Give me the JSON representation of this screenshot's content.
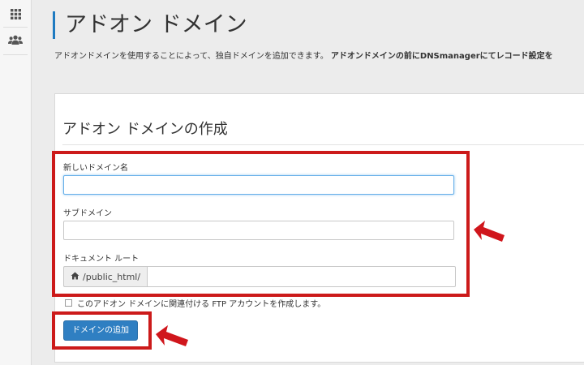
{
  "rail": {
    "icons": [
      "apps-grid-icon",
      "users-icon"
    ]
  },
  "page": {
    "title": "アドオン ドメイン",
    "description_plain": "アドオンドメインを使用することによって、独自ドメインを追加できます。",
    "description_bold": "アドオンドメインの前にDNSmanagerにてレコード設定を"
  },
  "form": {
    "title": "アドオン ドメインの作成",
    "new_domain_label": "新しいドメイン名",
    "new_domain_value": "",
    "subdomain_label": "サブドメイン",
    "subdomain_value": "",
    "document_root_label": "ドキュメント ルート",
    "document_root_prefix": "/public_html/",
    "document_root_value": "",
    "ftp_checkbox_label": "このアドオン ドメインに関連付ける FTP アカウントを作成します。",
    "ftp_checkbox_checked": false,
    "submit_label": "ドメインの追加"
  },
  "annotations": {
    "highlight_color": "#cc1a1a"
  },
  "colors": {
    "accent": "#1f7bc1",
    "button": "#2f7fc2"
  }
}
